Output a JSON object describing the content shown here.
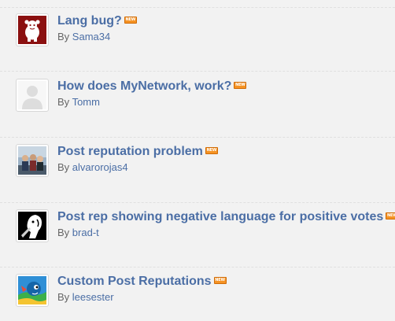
{
  "threads": [
    {
      "title": "Lang bug?",
      "by_label": "By",
      "author": "Sama34",
      "badge": "NEW",
      "avatar_icon": "red-mascot-avatar"
    },
    {
      "title": "How does MyNetwork, work?",
      "by_label": "By",
      "author": "Tomm",
      "badge": "NEW",
      "avatar_icon": "default-person-avatar"
    },
    {
      "title": "Post reputation problem",
      "by_label": "By",
      "author": "alvarorojas4",
      "badge": "NEW",
      "avatar_icon": "group-photo-avatar"
    },
    {
      "title": "Post rep showing negative language for positive votes",
      "by_label": "By",
      "author": "brad-t",
      "badge": "NEW",
      "avatar_icon": "black-white-silhouette-avatar"
    },
    {
      "title": "Custom Post Reputations",
      "by_label": "By",
      "author": "leesester",
      "badge": "NEW",
      "avatar_icon": "blue-cartoon-avatar"
    }
  ],
  "colors": {
    "background": "#f2f2f2",
    "link": "#4b6ea5",
    "meta_text": "#666666",
    "badge": "#f59324"
  }
}
